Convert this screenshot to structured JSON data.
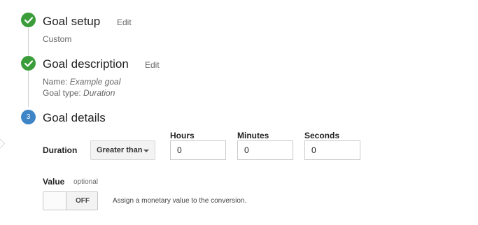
{
  "steps": [
    {
      "title": "Goal setup",
      "edit_label": "Edit",
      "summary": "Custom",
      "status": "complete",
      "icon": "check-icon"
    },
    {
      "title": "Goal description",
      "edit_label": "Edit",
      "name_label": "Name:",
      "name_value": "Example goal",
      "type_label": "Goal type:",
      "type_value": "Duration",
      "status": "complete",
      "icon": "check-icon"
    },
    {
      "title": "Goal details",
      "number": "3",
      "status": "active"
    }
  ],
  "duration": {
    "label": "Duration",
    "operator": "Greater than",
    "hours_label": "Hours",
    "hours_value": "0",
    "minutes_label": "Minutes",
    "minutes_value": "0",
    "seconds_label": "Seconds",
    "seconds_value": "0"
  },
  "value": {
    "label": "Value",
    "optional_label": "optional",
    "toggle_state": "OFF",
    "help_text": "Assign a monetary value to the conversion."
  },
  "colors": {
    "complete": "#3a9d3a",
    "active": "#3d85c6",
    "line": "#cfcfcf"
  }
}
